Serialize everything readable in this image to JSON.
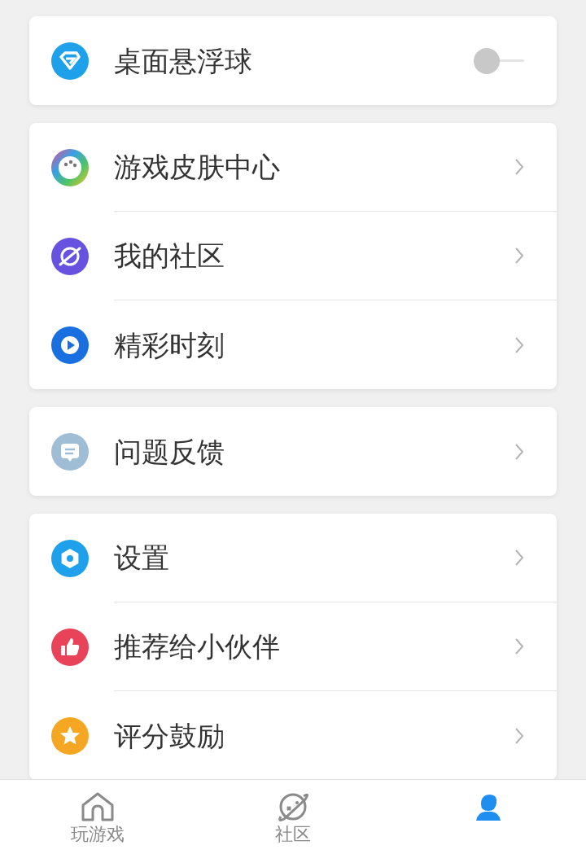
{
  "groups": [
    {
      "items": [
        {
          "label": "桌面悬浮球",
          "kind": "toggle",
          "on": false
        }
      ]
    },
    {
      "items": [
        {
          "label": "游戏皮肤中心",
          "kind": "link"
        },
        {
          "label": "我的社区",
          "kind": "link"
        },
        {
          "label": "精彩时刻",
          "kind": "link"
        }
      ]
    },
    {
      "items": [
        {
          "label": "问题反馈",
          "kind": "link"
        }
      ]
    },
    {
      "items": [
        {
          "label": "设置",
          "kind": "link"
        },
        {
          "label": "推荐给小伙伴",
          "kind": "link"
        },
        {
          "label": "评分鼓励",
          "kind": "link"
        }
      ]
    }
  ],
  "tabs": [
    {
      "label": "玩游戏",
      "selected": false
    },
    {
      "label": "社区",
      "selected": false
    },
    {
      "selected": true
    }
  ]
}
